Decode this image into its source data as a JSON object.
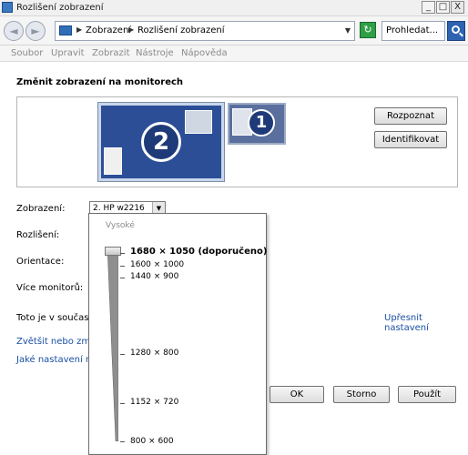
{
  "window": {
    "title": "Rozlišení zobrazení",
    "minimize": "_",
    "maximize": "□",
    "close": "X"
  },
  "address": {
    "back": "◄",
    "forward": "►",
    "crumbs": [
      "Zobrazení",
      "Rozlišení zobrazení"
    ],
    "crumb_arrow": "▶",
    "dropdown": "▼",
    "refresh": "↻",
    "search_placeholder": "Prohledat..."
  },
  "menu": [
    "Soubor",
    "Upravit",
    "Zobrazit",
    "Nástroje",
    "Nápověda"
  ],
  "main": {
    "heading": "Změnit zobrazení na monitorech",
    "monitors": [
      "2",
      "1"
    ],
    "detect_button": "Rozpoznat",
    "identify_button": "Identifikovat",
    "labels": {
      "display": "Zobrazení:",
      "resolution": "Rozlišení:",
      "orientation": "Orientace:",
      "multiple": "Více monitorů:"
    },
    "display_value": "2. HP w2216",
    "primary_text": "Toto je v současno",
    "advanced_link": "Upřesnit nastavení",
    "link_enlarge": "Zvětšit nebo zmenš",
    "link_settings": "Jaké nastavení mo",
    "ok": "OK",
    "cancel": "Storno",
    "apply": "Použít"
  },
  "resolution_popup": {
    "high_label": "Vysoké",
    "selected": "1680 × 1050 (doporučeno)",
    "options": [
      "1680 × 1050 (doporučeno)",
      "1600 × 1000",
      "1440 × 900",
      "1280 × 800",
      "1152 × 720",
      "800 × 600"
    ]
  }
}
